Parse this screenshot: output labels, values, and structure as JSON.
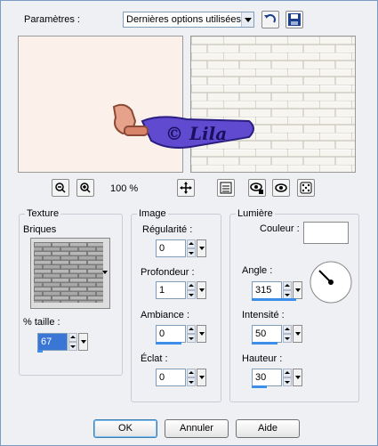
{
  "header": {
    "params_label": "Paramètres :",
    "preset_value": "Dernières options utilisées"
  },
  "watermark": {
    "text": "© Lila"
  },
  "zoom": {
    "level": "100 %"
  },
  "texture": {
    "title": "Texture",
    "name": "Briques",
    "size_label": "% taille :",
    "size_value": "67",
    "size_fraction": 0.12
  },
  "image": {
    "title": "Image",
    "regularity_label": "Régularité :",
    "regularity_value": "0",
    "depth_label": "Profondeur :",
    "depth_value": "1",
    "ambiance_label": "Ambiance :",
    "ambiance_value": "0",
    "ambiance_fraction": 0.5,
    "shine_label": "Éclat :",
    "shine_value": "0"
  },
  "light": {
    "title": "Lumière",
    "color_label": "Couleur :",
    "color_value": "#ffffff",
    "angle_label": "Angle :",
    "angle_value": "315",
    "angle_fraction": 0.88,
    "intensity_label": "Intensité :",
    "intensity_value": "50",
    "intensity_fraction": 0.5,
    "height_label": "Hauteur :",
    "height_value": "30",
    "height_fraction": 0.3
  },
  "buttons": {
    "ok": "OK",
    "cancel": "Annuler",
    "help": "Aide"
  },
  "colors": {
    "accent": "#3d8ee8",
    "preview_bg": "#fbf1ea",
    "watermark_purple": "#6a5acd"
  }
}
